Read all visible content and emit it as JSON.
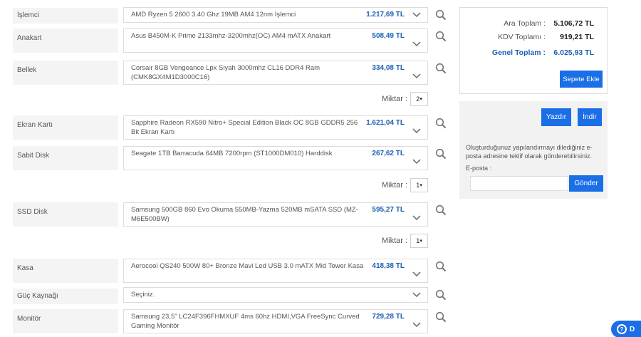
{
  "rows": [
    {
      "label": "İşlemci",
      "product": "AMD Ryzen 5 2600 3.40 Ghz 19MB AM4 12nm İşlemci",
      "price": "1.217,69 TL"
    },
    {
      "label": "Anakart",
      "product": "Asus B450M-K Prime 2133mhz-3200mhz(OC) AM4 mATX Anakart",
      "price": "508,49 TL"
    },
    {
      "label": "Bellek",
      "product": "Corsair 8GB Vengeance Lpx Siyah 3000mhz CL16 DDR4 Ram (CMK8GX4M1D3000C16)",
      "price": "334,08 TL"
    },
    {
      "label": "Ekran Kartı",
      "product": "Sapphire Radeon RX590 Nitro+ Special Edition Black OC 8GB GDDR5 256 Bit Ekran Kartı",
      "price": "1.621,04 TL"
    },
    {
      "label": "Sabit Disk",
      "product": "Seagate 1TB Barracuda 64MB 7200rpm (ST1000DM010) Harddisk",
      "price": "267,62 TL"
    },
    {
      "label": "SSD Disk",
      "product": "Samsung 500GB 860 Evo Okuma 550MB-Yazma 520MB mSATA SSD (MZ-M6E500BW)",
      "price": "595,27 TL"
    },
    {
      "label": "Kasa",
      "product": "Aerocool QS240 500W 80+ Bronze Mavi Led USB 3.0 mATX Mid Tower Kasa",
      "price": "418,38 TL"
    },
    {
      "label": "Güç Kaynağı",
      "product": "Seçiniz.",
      "price": ""
    },
    {
      "label": "Monitör",
      "product": "Samsung 23,5\" LC24F396FHMXUF 4ms 60hz HDMI,VGA FreeSync Curved Gaming Monitör",
      "price": "729,28 TL"
    }
  ],
  "quantities": [
    {
      "label": "Miktar :",
      "value": "2"
    },
    {
      "label": "Miktar :",
      "value": "1"
    },
    {
      "label": "Miktar :",
      "value": "1"
    }
  ],
  "summary": {
    "subtotal_label": "Ara Toplam :",
    "subtotal_value": "5.106,72 TL",
    "vat_label": "KDV Toplamı :",
    "vat_value": "919,21 TL",
    "total_label": "Genel Toplam :",
    "total_value": "6.025,93 TL",
    "add_to_cart": "Sepete Ekle"
  },
  "export": {
    "print_label": "Yazdır",
    "download_label": "İndir",
    "info_text": "Oluşturduğunuz yapılandırmayı dilediğiniz e-posta adresine teklif olarak gönderebilirsiniz.",
    "email_label": "E-posta :",
    "email_value": "",
    "send_label": "Gönder"
  },
  "help": {
    "label": "D"
  },
  "colors": {
    "accent": "#1a6ee6",
    "price": "#1a5fb4",
    "label_bg": "#f4f4f4"
  },
  "icons": {
    "dropdown": "chevron-down-icon",
    "search": "magnifier-icon",
    "help": "question-circle-icon"
  }
}
